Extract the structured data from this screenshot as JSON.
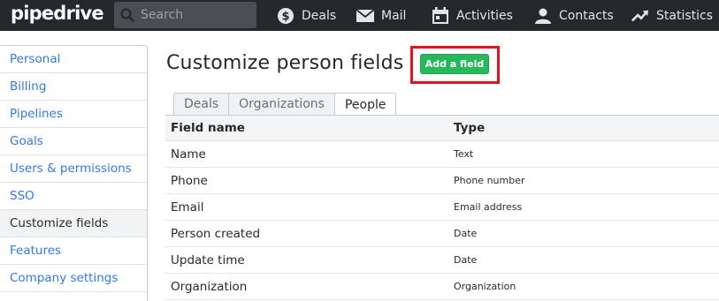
{
  "header": {
    "logo": "pipedrive",
    "search_placeholder": "Search",
    "nav": [
      {
        "label": "Deals",
        "icon": "dollar-coin-icon"
      },
      {
        "label": "Mail",
        "icon": "envelope-icon"
      },
      {
        "label": "Activities",
        "icon": "calendar-icon"
      },
      {
        "label": "Contacts",
        "icon": "person-icon"
      },
      {
        "label": "Statistics",
        "icon": "trend-up-icon"
      }
    ]
  },
  "sidebar": {
    "items": [
      {
        "label": "Personal"
      },
      {
        "label": "Billing"
      },
      {
        "label": "Pipelines"
      },
      {
        "label": "Goals"
      },
      {
        "label": "Users & permissions"
      },
      {
        "label": "SSO"
      },
      {
        "label": "Customize fields"
      },
      {
        "label": "Features"
      },
      {
        "label": "Company settings"
      }
    ],
    "active": "Customize fields"
  },
  "main": {
    "title": "Customize person fields",
    "add_button": "Add a field",
    "tabs": [
      {
        "label": "Deals"
      },
      {
        "label": "Organizations"
      },
      {
        "label": "People"
      }
    ],
    "active_tab": "People",
    "table": {
      "headers": [
        "Field name",
        "Type"
      ],
      "rows": [
        {
          "name": "Name",
          "type": "Text"
        },
        {
          "name": "Phone",
          "type": "Phone number"
        },
        {
          "name": "Email",
          "type": "Email address"
        },
        {
          "name": "Person created",
          "type": "Date"
        },
        {
          "name": "Update time",
          "type": "Date"
        },
        {
          "name": "Organization",
          "type": "Organization"
        }
      ]
    }
  },
  "colors": {
    "topbar": "#26292c",
    "link": "#317ae2",
    "add_button": "#26b85a",
    "highlight": "#e5101f"
  }
}
